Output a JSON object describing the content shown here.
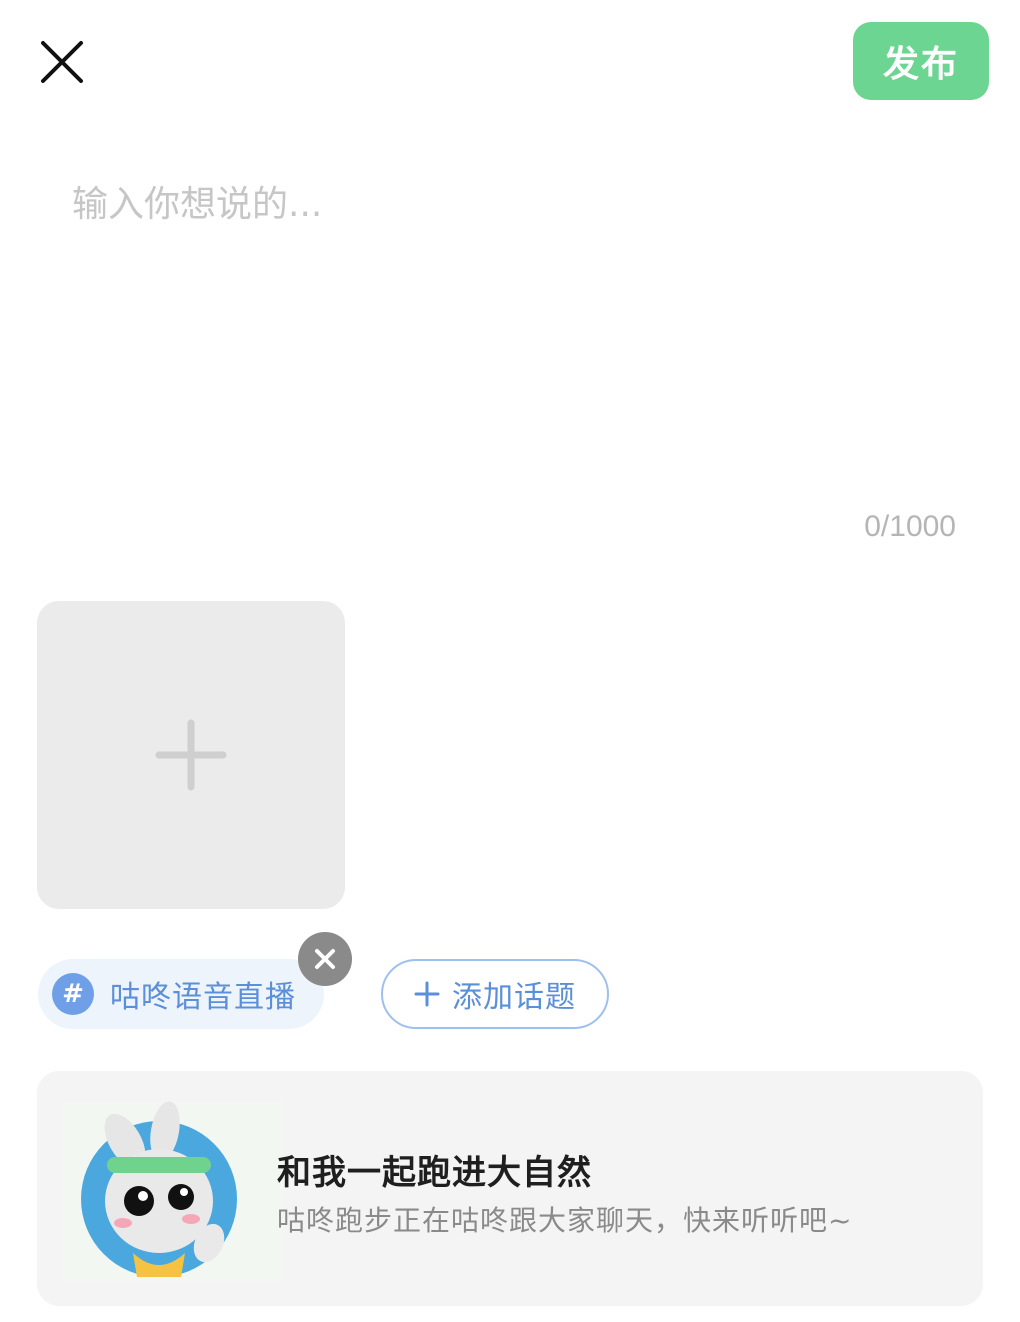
{
  "header": {
    "close_icon": "close-icon",
    "publish_label": "发布",
    "publish_color": "#6dd592"
  },
  "editor": {
    "placeholder": "输入你想说的...",
    "value": "",
    "char_count": "0/1000"
  },
  "media": {
    "add_icon": "plus-icon"
  },
  "topics": {
    "selected": {
      "icon": "hashtag-icon",
      "label": "咕咚语音直播",
      "remove_icon": "close-icon"
    },
    "add_button": {
      "icon": "plus-icon",
      "label": "添加话题"
    },
    "accent_color": "#5b8fd9"
  },
  "live_card": {
    "avatar": "bunny-mascot-avatar",
    "title": "和我一起跑进大自然",
    "subtitle": "咕咚跑步正在咕咚跟大家聊天，快来听听吧~"
  }
}
